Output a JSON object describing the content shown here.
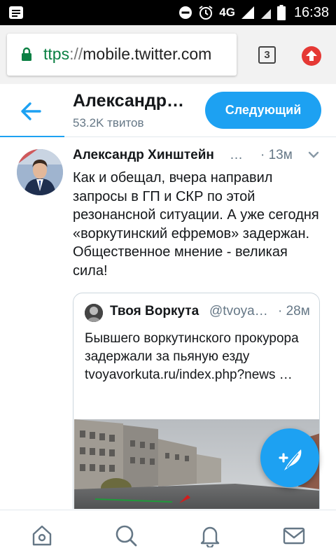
{
  "status_bar": {
    "network": "4G",
    "time": "16:38",
    "icons": [
      "notification-icon",
      "dnd-icon",
      "alarm-icon",
      "signal-icon",
      "wifi-icon",
      "battery-icon"
    ]
  },
  "browser": {
    "url_scheme": "ttps",
    "url_sep": "://",
    "url_host": "mobile.twitter.com",
    "tabs_count": "3",
    "icons": [
      "lock-icon",
      "upload-icon"
    ]
  },
  "profile": {
    "name": "Александр…",
    "tweet_count": "53.2K твитов",
    "follow_label": "Следующий"
  },
  "tweet": {
    "author": "Александр Хинштейн",
    "ellipsis": "…",
    "time": "· 13м",
    "text": "Как и обещал, вчера направил запросы в ГП и СКР по этой резонансной ситуации. А уже сегодня «воркутинский ефремов» задержан. Общественное мнение - великая сила!",
    "quote": {
      "author": "Твоя Воркута",
      "handle": "@tvoya…",
      "time": "· 28м",
      "text": "Бывшего воркутинского прокурора задержали за пьяную езду tvoyavorkuta.ru/index.php?news …"
    }
  },
  "colors": {
    "accent": "#1da1f2",
    "secondary_text": "#657786",
    "status_bar": "#000000",
    "lock": "#0b8043",
    "upload": "#e53935"
  },
  "nav": {
    "items": [
      "home-icon",
      "search-icon",
      "notifications-icon",
      "messages-icon"
    ]
  }
}
